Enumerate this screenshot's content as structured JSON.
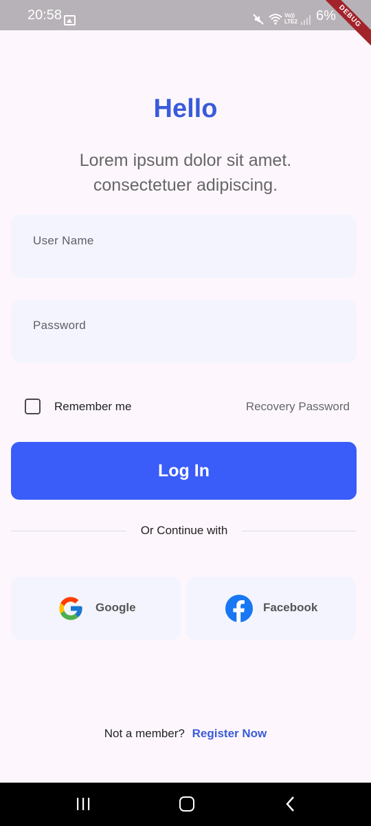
{
  "status_bar": {
    "time": "20:58",
    "network_label_top": "Vo))",
    "network_label_bottom": "LTE2",
    "battery": "6%",
    "debug_banner": "DEBUG",
    "icons": [
      "gallery-icon",
      "mute-icon",
      "wifi-icon",
      "signal-icon",
      "battery-icon"
    ]
  },
  "header": {
    "title": "Hello",
    "subtitle": "Lorem ipsum dolor sit amet. consectetuer adipiscing."
  },
  "form": {
    "username_label": "User Name",
    "password_label": "Password",
    "remember_me": "Remember me",
    "remember_checked": false,
    "recovery_password": "Recovery Password",
    "login_button": "Log In"
  },
  "divider": {
    "text": "Or Continue with"
  },
  "social": {
    "google_label": "Google",
    "facebook_label": "Facebook"
  },
  "footer": {
    "prompt": "Not a member?",
    "register_link": "Register Now"
  },
  "colors": {
    "primary": "#3a5cf9",
    "title": "#3a5bd9",
    "background": "#fdf7fd",
    "field_bg": "#f3f4fd"
  }
}
